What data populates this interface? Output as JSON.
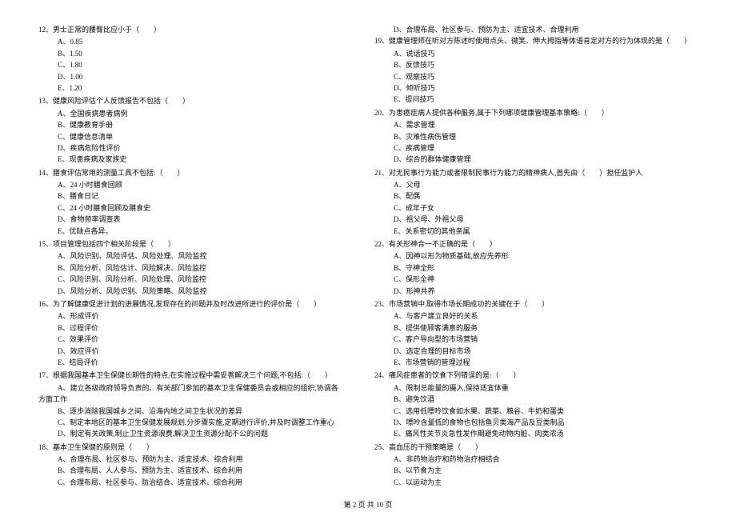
{
  "footer": "第 2 页 共 10 页",
  "left": {
    "q12": {
      "text": "12、男士正常的腰臀比应小于（　　）",
      "opts": [
        "A、0.85",
        "B、1.50",
        "C、1.80",
        "D、1.00",
        "E、1.20"
      ]
    },
    "q13": {
      "text": "13、健康风险评估个人反馈报告不包括（　　）",
      "opts": [
        "A、全国疾病患者病例",
        "B、健康教育手册",
        "C、健康信息清单",
        "D、疾病危险性评价",
        "E、现患疾病及家族史"
      ]
    },
    "q14": {
      "text": "14、膳食评估常用的测量工具不包括:（　　）",
      "opts": [
        "A、24 小时膳食回顾",
        "B、膳食日记",
        "C、24 小时膳食回顾及膳食史",
        "D、食物频率调查表",
        "E、优缺点各异。"
      ]
    },
    "q15": {
      "text": "15、项目管理包括四个相关阶段是（　　）",
      "opts": [
        "A、风险识别、风险评估、风险处理、风险监控",
        "B、风险分析、风险估计、风险解决、风险监控",
        "C、风险识别、风险分析、风险处理、风险监控",
        "D、风险分析、风险识别、风险策略、风险监控"
      ]
    },
    "q16": {
      "text": "16、为了解健康促进计划的进展情况,发现存在的问题并及时改进所进行的评价是（　　）",
      "opts": [
        "A、形成评价",
        "B、过程评价",
        "C、效果评价",
        "D、效应评价",
        "E、结局评价"
      ]
    },
    "q17": {
      "text": "17、根据我国基本卫生保健长期性的特点,在实施过程中需妥善解决三个问题,不包括:（　　）",
      "optA_line1": "A、建立各级政府领导负责的、有关部门参加的基本卫生保健委员会或相应的组织,协调各",
      "optA_line2": "方面工作",
      "opts": [
        "B、逐步消除我国城乡之间、沿海内地之间卫生状况的差异",
        "C、制定本地区的基本卫生保健发展规划,分步骤实施,定期进行评价,并及时调整工作重心",
        "D、制定有关政策,制止卫生资源浪费,解决卫生资源分配不公的问题"
      ]
    },
    "q18": {
      "text": "18、基本卫生保健的原则是（　　）",
      "opts": [
        "A、合理布局、社区参与、预防为主、适宜技术、综合利用",
        "B、合理布局、人人参与、预防为主、适宜技术、综合利用",
        "C、合理布局、社区参与、防治结合、适宜技术、综合利用"
      ]
    }
  },
  "right": {
    "q18d": "D、合理布局、社区参与、预防为主、适宜技术、合理利用",
    "q19": {
      "text": "19、健康管理师在听对方陈述时使用点头、微笑、伸大拇指等体语肯定对方的行为体现的是（　　）",
      "opts": [
        "A、说话技巧",
        "B、反馈技巧",
        "C、观察技巧",
        "D、倾听技巧",
        "E、提问技巧"
      ]
    },
    "q20": {
      "text": "20、为患癌症病人提供各种服务,属于下列哪项健康管理基本策略:（　　）",
      "opts": [
        "A、需求管理",
        "B、灾难性病伤管理",
        "C、疾病管理",
        "D、综合的群体健康管理"
      ]
    },
    "q21": {
      "text": "21、对无民事行为能力或者限制民事行为能力的精神病人,首先由（　　）担任监护人",
      "opts": [
        "A、父母",
        "B、配偶",
        "C、成年子女",
        "D、祖父母、外祖父母",
        "E、关系密切的其他亲属"
      ]
    },
    "q22": {
      "text": "22、有关形神合一不正确的是（　　）",
      "opts": [
        "A、因神以形为物质基础,故应先养形",
        "B、守神全形",
        "C、保形全神",
        "D、形神共养"
      ]
    },
    "q23": {
      "text": "23、市场营销中,取得市场长期成功的关键在于（　　）",
      "opts": [
        "A、与客户建立良好的关系",
        "B、提供使顾客满意的服务",
        "C、客户导向型的市场营销",
        "D、选定合理的目标市场",
        "E、市场营销的管理过程"
      ]
    },
    "q24": {
      "text": "24、痛风症患者的饮食下列错误的是:（　　）",
      "opts": [
        "A、限制总能量的摄入,保持适宜体重",
        "B、避免饮酒",
        "C、选用低嘌呤饮食如水果、蔬菜、粮谷、牛奶和蛋类",
        "D、嘌呤含量低的食物也包括鱼贝类海产品及豆类制品",
        "E、痛风性关节炎急性发作期避免动物内脏、肉类浓汤"
      ]
    },
    "q25": {
      "text": "25、高血压的干预策略是（　　）",
      "opts": [
        "A、非药物治疗和药物治疗相结合",
        "B、以节食为主",
        "C、以运动为主"
      ]
    }
  }
}
